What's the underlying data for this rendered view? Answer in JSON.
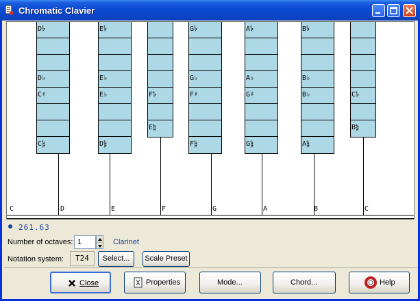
{
  "window": {
    "title": "Chromatic Clavier"
  },
  "keyboard": {
    "columns": [
      {
        "id": "D",
        "cells": [
          "D𝄳",
          "",
          "",
          "D♭",
          "C♯",
          "",
          "",
          "C𝄲"
        ]
      },
      {
        "id": "E",
        "cells": [
          "E𝄳",
          "",
          "",
          "E♭",
          "E♭",
          "",
          "",
          "D𝄲"
        ]
      },
      {
        "id": "F",
        "cells": [
          "",
          "",
          "",
          "",
          "F𝄳",
          "",
          "E𝄲",
          ""
        ]
      },
      {
        "id": "G",
        "cells": [
          "G𝄳",
          "",
          "",
          "G♭",
          "F♯",
          "",
          "",
          "F𝄲"
        ]
      },
      {
        "id": "A",
        "cells": [
          "A𝄳",
          "",
          "",
          "A♭",
          "G♯",
          "",
          "",
          "G𝄲"
        ]
      },
      {
        "id": "B",
        "cells": [
          "B𝄳",
          "",
          "",
          "B♭",
          "B♭",
          "",
          "",
          "A𝄲"
        ]
      },
      {
        "id": "C2",
        "cells": [
          "",
          "",
          "",
          "",
          "C𝄳",
          "",
          "B𝄲",
          ""
        ]
      }
    ],
    "white_labels": [
      "C",
      "D",
      "E",
      "F",
      "G",
      "A",
      "B",
      "C"
    ]
  },
  "status": {
    "frequency": "261.63",
    "octaves_label": "Number of octaves:",
    "octaves_value": "1",
    "instrument": "Clarinet",
    "notation_label": "Notation system:",
    "notation_value": "T24",
    "select_label": "Select...",
    "scale_preset_label": "Scale Preset"
  },
  "buttons": {
    "close": "Close",
    "properties": "Properties",
    "mode": "Mode...",
    "chord": "Chord...",
    "help": "Help"
  },
  "colors": {
    "key_fill": "#add8e6",
    "title_bar": "#0a4ad4",
    "accent_text": "#1a3fa0"
  }
}
